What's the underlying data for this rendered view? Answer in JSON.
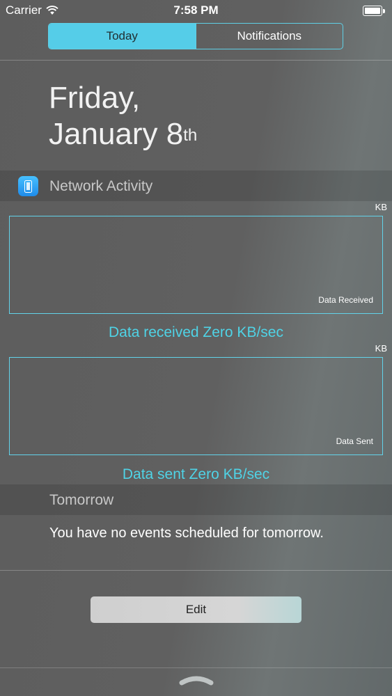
{
  "status_bar": {
    "carrier": "Carrier",
    "time": "7:58 PM"
  },
  "segmented": {
    "today": "Today",
    "notifications": "Notifications"
  },
  "date": {
    "line1": "Friday,",
    "line2": "January 8",
    "suffix": "th"
  },
  "network_widget": {
    "title": "Network Activity",
    "received": {
      "unit": "KB",
      "caption": "Data Received",
      "rate_text": "Data received Zero KB/sec"
    },
    "sent": {
      "unit": "KB",
      "caption": "Data Sent",
      "rate_text": "Data sent Zero KB/sec"
    }
  },
  "tomorrow": {
    "title": "Tomorrow",
    "message": "You have no events scheduled for tomorrow."
  },
  "edit_label": "Edit",
  "colors": {
    "accent": "#55cde8",
    "rate_text": "#4fd3e6",
    "app_icon": "#2a9cf0"
  }
}
